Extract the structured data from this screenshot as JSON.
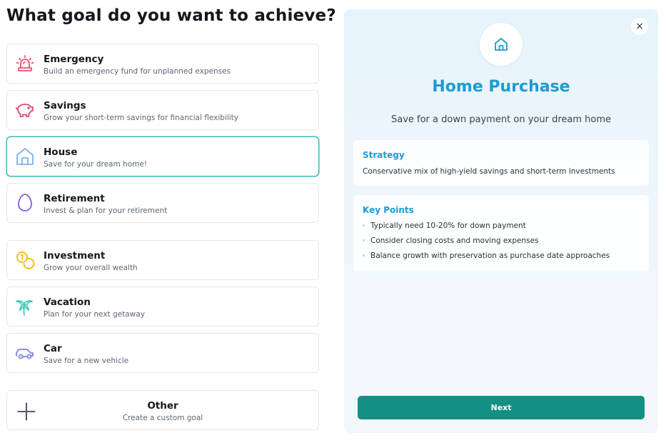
{
  "page": {
    "title": "What goal do you want to achieve?"
  },
  "goals": [
    {
      "key": "emergency",
      "label": "Emergency",
      "description": "Build an emergency fund for unplanned expenses",
      "icon": "siren-icon",
      "color": "#ef4f6e"
    },
    {
      "key": "savings",
      "label": "Savings",
      "description": "Grow your short-term savings for financial flexibility",
      "icon": "piggy-bank-icon",
      "color": "#e6467d"
    },
    {
      "key": "house",
      "label": "House",
      "description": "Save for your dream home!",
      "icon": "house-icon",
      "color": "#7fb3e6",
      "selected": true
    },
    {
      "key": "retirement",
      "label": "Retirement",
      "description": "Invest & plan for your retirement",
      "icon": "egg-icon",
      "color": "#8a5cde"
    },
    {
      "key": "investment",
      "label": "Investment",
      "description": "Grow your overall wealth",
      "icon": "coins-icon",
      "color": "#f0b90e"
    },
    {
      "key": "vacation",
      "label": "Vacation",
      "description": "Plan for your next getaway",
      "icon": "palm-tree-icon",
      "color": "#3cc9b3"
    },
    {
      "key": "car",
      "label": "Car",
      "description": "Save for a new vehicle",
      "icon": "car-icon",
      "color": "#7b82e6"
    },
    {
      "key": "other",
      "label": "Other",
      "description": "Create a custom goal",
      "icon": "plus-icon",
      "color": "#555c66"
    }
  ],
  "detail": {
    "close_label": "×",
    "icon": "house-icon",
    "title": "Home Purchase",
    "subtitle": "Save for a down payment on your dream home",
    "strategy_heading": "Strategy",
    "strategy_text": "Conservative mix of high-yield savings and short-term investments",
    "key_points_heading": "Key Points",
    "key_points": [
      "Typically need 10-20% for down payment",
      "Consider closing costs and moving expenses",
      "Balance growth with preservation as purchase date approaches"
    ],
    "next_label": "Next"
  },
  "colors": {
    "accent": "#1d9bd6",
    "primary_button": "#148f84",
    "selected_border": "#3fb9b0"
  }
}
